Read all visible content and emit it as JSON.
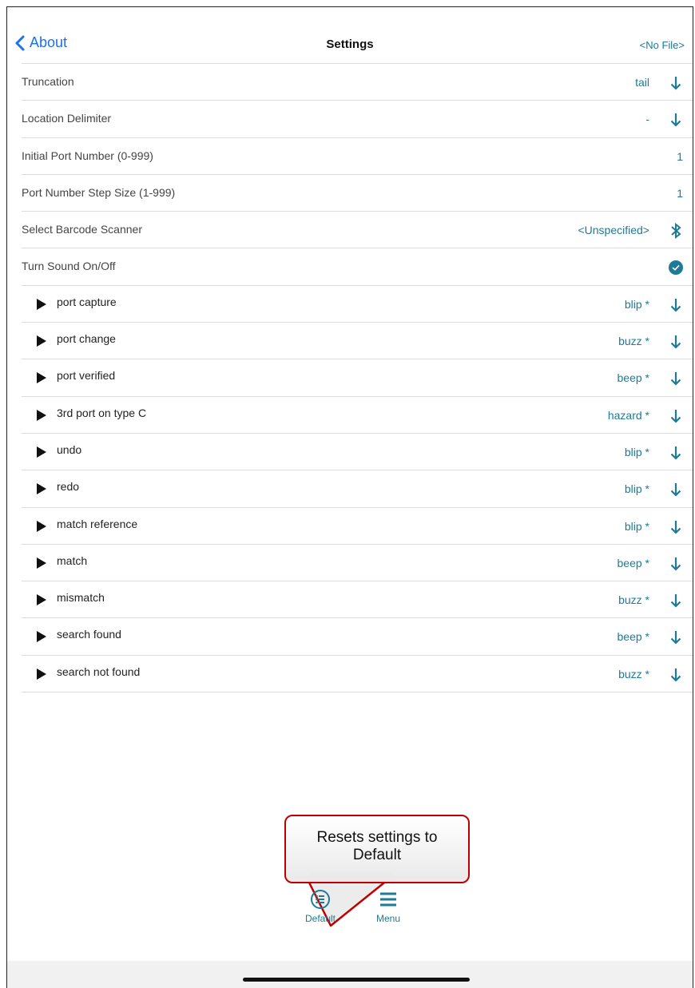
{
  "nav": {
    "back_label": "About",
    "title": "Settings",
    "file_label": "<No File>"
  },
  "rows": [
    {
      "label": "Truncation",
      "value": "tail",
      "icon": "arrow-down-icon"
    },
    {
      "label": "Location Delimiter",
      "value": "-",
      "icon": "arrow-down-icon"
    },
    {
      "label": "Initial Port Number (0-999)",
      "value": "1"
    },
    {
      "label": "Port Number Step Size (1-999)",
      "value": "1"
    },
    {
      "label": "Select Barcode Scanner",
      "value": "<Unspecified>",
      "icon": "bluetooth-icon"
    },
    {
      "label": "Turn Sound On/Off",
      "value": "",
      "icon": "check-circle-icon"
    }
  ],
  "sounds": [
    {
      "label": "port capture",
      "value": "blip *"
    },
    {
      "label": "port change",
      "value": "buzz *"
    },
    {
      "label": "port verified",
      "value": "beep *"
    },
    {
      "label": "3rd port on type C",
      "value": "hazard *"
    },
    {
      "label": "undo",
      "value": "blip *"
    },
    {
      "label": "redo",
      "value": "blip *"
    },
    {
      "label": "match reference",
      "value": "blip *"
    },
    {
      "label": "match",
      "value": "beep *"
    },
    {
      "label": "mismatch",
      "value": "buzz *"
    },
    {
      "label": "search found",
      "value": "beep *"
    },
    {
      "label": "search not found",
      "value": "buzz *"
    }
  ],
  "callout": {
    "line1": "Resets settings to",
    "line2": "Default"
  },
  "tabs": {
    "default_label": "Default",
    "menu_label": "Menu"
  },
  "colors": {
    "accent": "#1e7a96",
    "link": "#1a73e8",
    "callout_border": "#c00000"
  }
}
